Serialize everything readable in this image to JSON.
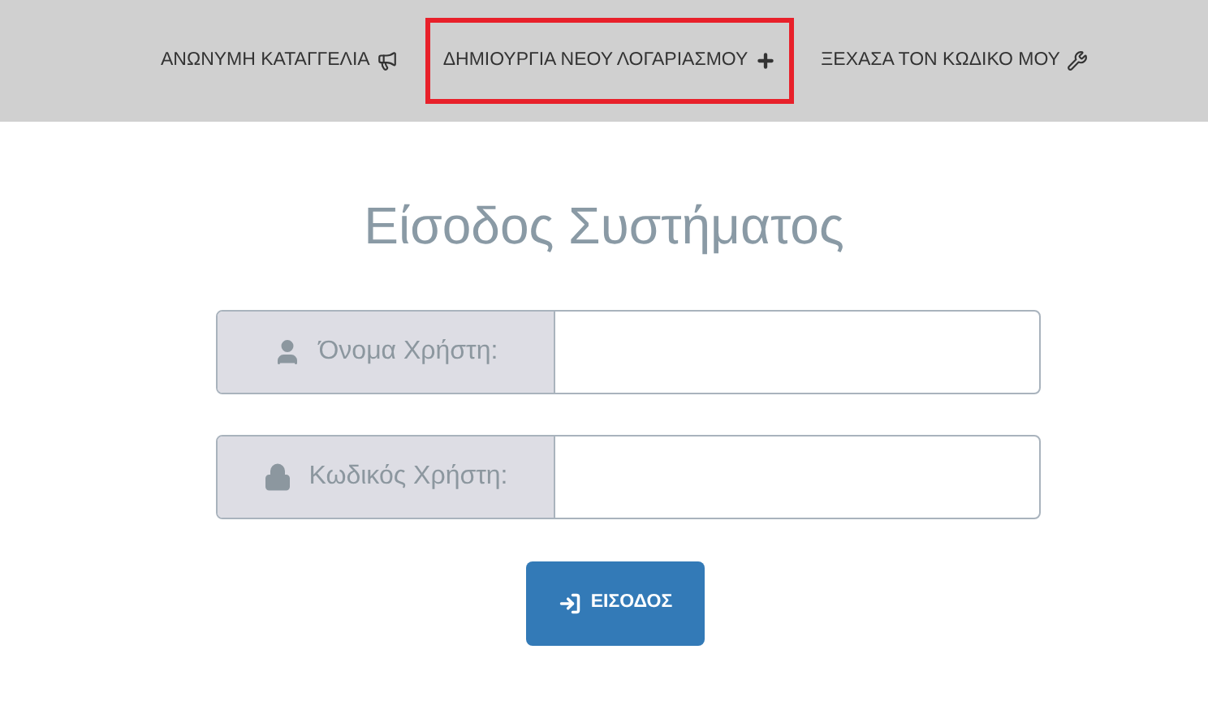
{
  "nav": [
    {
      "kind": "report",
      "label": "ΑΝΩΝΥΜΗ ΚΑΤΑΓΓΕΛΙΑ",
      "highlighted": false
    },
    {
      "kind": "register",
      "label": "ΔΗΜΙΟΥΡΓΙΑ ΝΕΟΥ ΛΟΓΑΡΙΑΣΜΟΥ",
      "highlighted": true
    },
    {
      "kind": "forgot",
      "label": "ΞΕΧΑΣΑ ΤΟΝ ΚΩΔΙΚΟ ΜΟΥ",
      "highlighted": false
    }
  ],
  "title": "Είσοδος Συστήματος",
  "fields": [
    {
      "kind": "user",
      "label": "Όνομα Χρήστη:"
    },
    {
      "kind": "password",
      "label": "Κωδικός Χρήστη:"
    }
  ],
  "submit": {
    "label": "ΕΙΣΟΔΟΣ"
  }
}
